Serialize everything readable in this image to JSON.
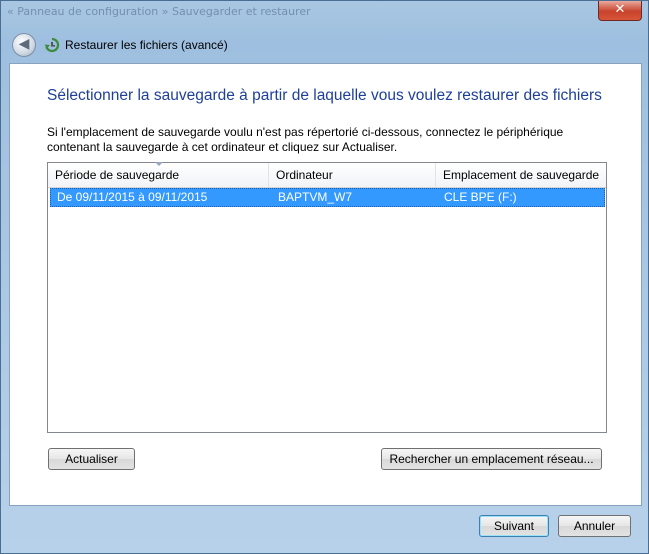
{
  "window": {
    "breadcrumb": "« Panneau de configuration » Sauvegarder et restaurer",
    "close_glyph": "✕"
  },
  "navbar": {
    "title": "Restaurer les fichiers (avancé)",
    "back_glyph": "◀"
  },
  "page": {
    "heading": "Sélectionner la sauvegarde à partir de laquelle vous voulez restaurer des fichiers",
    "description_line1": "Si l'emplacement de sauvegarde voulu n'est pas répertorié ci-dessous, connectez le périphérique",
    "description_line2": "contenant la sauvegarde à cet ordinateur et cliquez sur Actualiser."
  },
  "table": {
    "columns": [
      "Période de sauvegarde",
      "Ordinateur",
      "Emplacement de sauvegarde"
    ],
    "rows": [
      [
        "De 09/11/2015 à 09/11/2015",
        "BAPTVM_W7",
        "CLE BPE (F:)"
      ]
    ]
  },
  "buttons": {
    "refresh": "Actualiser",
    "browse_network": "Rechercher un emplacement réseau...",
    "next": "Suivant",
    "cancel": "Annuler"
  },
  "colors": {
    "heading": "#1e3f9a",
    "selection": "#3399ff"
  }
}
